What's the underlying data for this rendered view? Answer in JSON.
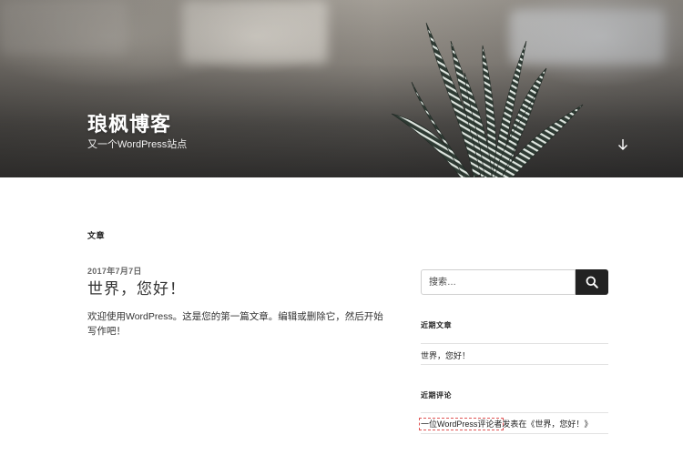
{
  "site": {
    "title": "琅枫博客",
    "description": "又一个WordPress站点"
  },
  "main": {
    "page_title": "文章",
    "post": {
      "date": "2017年7月7日",
      "title": "世界，您好！",
      "excerpt": "欢迎使用WordPress。这是您的第一篇文章。编辑或删除它，然后开始写作吧！"
    }
  },
  "sidebar": {
    "search": {
      "placeholder": "搜索…"
    },
    "recent_posts": {
      "title": "近期文章",
      "items": [
        "世界，您好！"
      ]
    },
    "recent_comments": {
      "title": "近期评论",
      "items": [
        {
          "author": "一位WordPress评论者",
          "connector": "发表在《",
          "post": "世界，您好！",
          "close": "》"
        }
      ]
    }
  },
  "icons": {
    "scroll_down": "arrow-down-icon",
    "search": "search-icon"
  },
  "colors": {
    "search_button": "#222222",
    "text": "#222222",
    "header_text": "#ffffff"
  }
}
